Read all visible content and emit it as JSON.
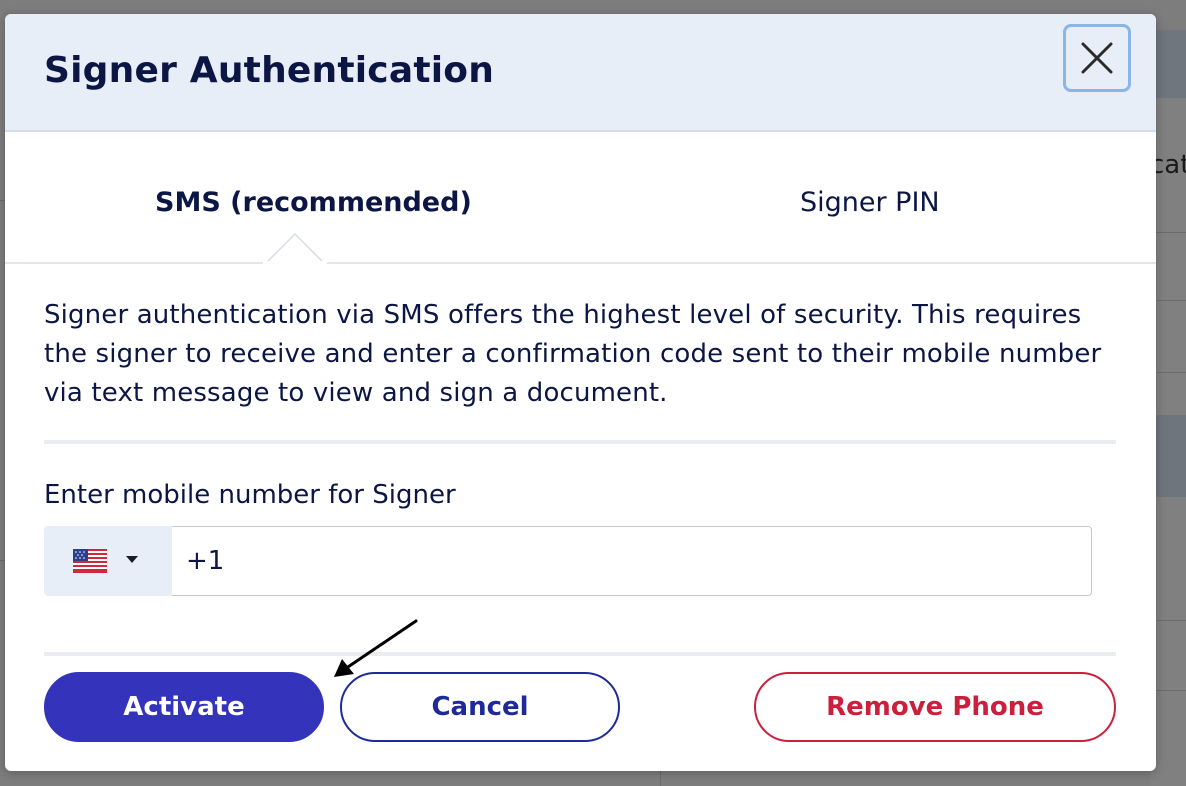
{
  "modal": {
    "title": "Signer Authentication",
    "close_icon": "close-icon"
  },
  "tabs": [
    {
      "label": "SMS (recommended)",
      "active": true
    },
    {
      "label": "Signer PIN",
      "active": false
    }
  ],
  "description": "Signer authentication via SMS offers the highest level of security. This requires the signer to receive and enter a confirmation code sent to their mobile number via text message to view and sign a document.",
  "phone": {
    "label": "Enter mobile number for Signer",
    "country_icon": "us-flag-icon",
    "value": "+1"
  },
  "buttons": {
    "activate": "Activate",
    "cancel": "Cancel",
    "remove": "Remove Phone"
  },
  "background": {
    "partial_text": "cat"
  },
  "colors": {
    "primary": "#3333bb",
    "secondary": "#1f2a9a",
    "danger": "#cc1f3c",
    "header_bg": "#e8eef7",
    "text": "#0c1645"
  }
}
